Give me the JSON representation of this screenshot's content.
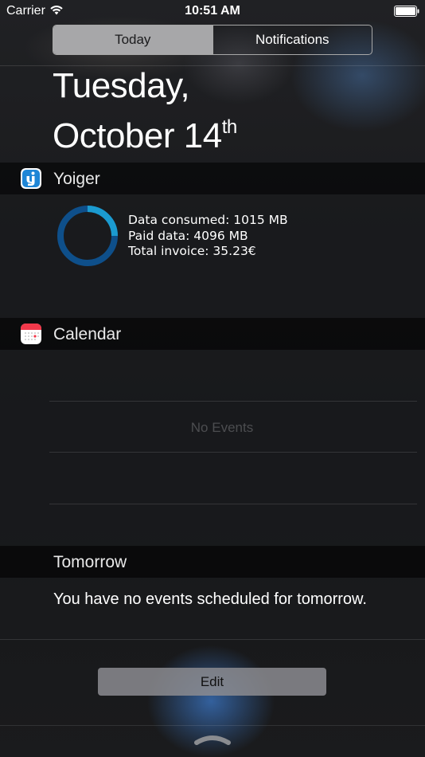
{
  "status_bar": {
    "carrier": "Carrier",
    "time": "10:51 AM"
  },
  "segmented_control": {
    "tabs": [
      {
        "label": "Today",
        "selected": true
      },
      {
        "label": "Notifications",
        "selected": false
      }
    ]
  },
  "date": {
    "weekday": "Tuesday,",
    "month_day": "October 14",
    "suffix": "th"
  },
  "yoiger": {
    "title": "Yoiger",
    "icon": "yoiger-app-icon",
    "usage_fraction": 0.25,
    "ring_colors": {
      "used": "#1b9bd0",
      "remaining": "#0e4f8a"
    },
    "lines": [
      "Data consumed: 1015 MB",
      "Paid data: 4096 MB",
      "Total invoice: 35.23€"
    ]
  },
  "calendar": {
    "title": "Calendar",
    "icon": "calendar-app-icon",
    "empty_text": "No Events"
  },
  "tomorrow": {
    "title": "Tomorrow",
    "message": "You have no events scheduled for tomorrow."
  },
  "edit_button": {
    "label": "Edit"
  },
  "icons": {
    "wifi": "wifi-icon",
    "battery": "battery-icon",
    "grabber": "chevron-up-icon"
  }
}
